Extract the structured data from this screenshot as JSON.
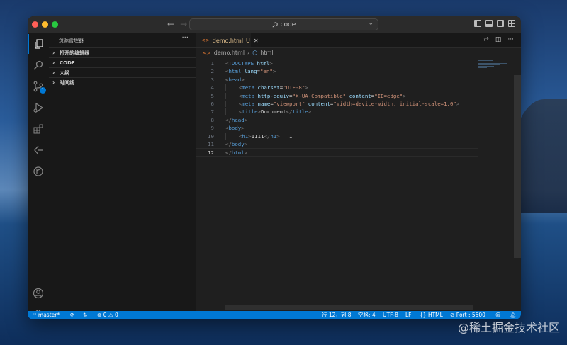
{
  "window": {
    "command_center": "code"
  },
  "sidebar": {
    "title": "资源管理器",
    "sections": [
      "打开的编辑器",
      "CODE",
      "大纲",
      "时间线"
    ]
  },
  "activity": {
    "scm_badge": "1"
  },
  "editor": {
    "tab": {
      "label": "demo.html",
      "modified": "U"
    },
    "breadcrumb": {
      "file": "demo.html",
      "symbol": "html"
    },
    "line_numbers": [
      "1",
      "2",
      "3",
      "4",
      "5",
      "6",
      "7",
      "8",
      "9",
      "10",
      "11",
      "12"
    ]
  },
  "status": {
    "branch": "master*",
    "problems_errors": "0",
    "problems_warnings": "0",
    "cursor": "行 12，列 8",
    "spaces": "空格: 4",
    "encoding": "UTF-8",
    "eol": "LF",
    "language": "HTML",
    "port": "Port : 5500"
  },
  "watermark": "@稀土掘金技术社区",
  "colors": {
    "accent": "#0078d4",
    "tag": "#569cd6",
    "attr": "#9cdcfe",
    "string": "#ce9178"
  }
}
